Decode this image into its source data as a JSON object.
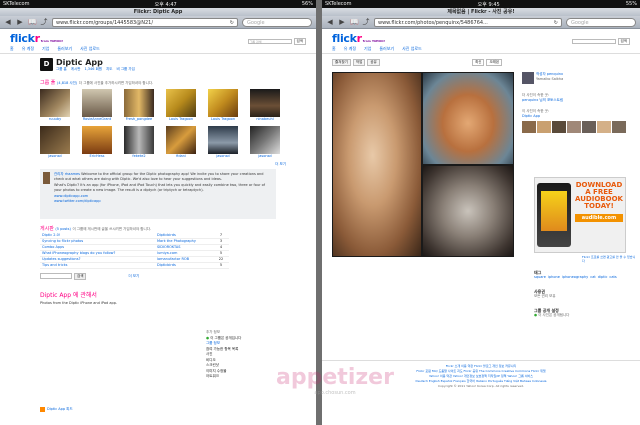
{
  "left": {
    "status": {
      "carrier": "SKTelecom",
      "time": "오후 4:47",
      "battery": "56%"
    },
    "browser_title": "Flickr: Diptic App",
    "url": "www.flickr.com/groups/1445583@N21/",
    "search_placeholder": "Google",
    "nav": [
      "홈",
      "유 계정",
      "기업",
      "둘러보기",
      "사진 업로드"
    ],
    "site_search_placeholder": "그룹 검색",
    "group": {
      "name": "Diptic App",
      "tabs": [
        "그룹 홈",
        "게시판",
        "1,346 회원",
        "지도",
        "비 그룹 가입"
      ],
      "pool_title": "그룹 풀",
      "pool_count": "(4,818 사진)",
      "pool_note": "더 그룹에 사진을 추가하시려면 가입하셔야 합니다.",
      "thumbs": [
        "ruuuby",
        "RosieAnneGrant",
        "Fresh_pongdee",
        "Louis Tragoon",
        "Louis Tragoon",
        "ninabeuhl",
        "jasonsd",
        "EricHess",
        "fekete2",
        "fidani",
        "jasonsd",
        "jasonsd"
      ],
      "more_link": "더 보기",
      "admin": "관리자 rhaames",
      "description": "Welcome to the official group for the Diptic photography app! We invite you to share your creations and check out what others are doing with Diptic. We'd also love to hear your suggestions and ideas.",
      "description2": "What's Diptic? It's an app (for iPhone, iPad and iPod Touch) that lets you quickly and easily combine two, three or four of your photos to create a new image. The result is a diptych (or triptych or tetraptych).",
      "links": [
        "www.dipticapp.com",
        "www.twitter.com/dipticapp"
      ],
      "discussion_title": "게시판",
      "discussion_count": "(5 posts)",
      "discussion_note": "이 그룹에 게시판에 글을 쓰시려면 가입하셔야 합니다.",
      "threads": [
        {
          "title": "Diptic 2.0!",
          "author": "Dipticbirds",
          "count": "7"
        },
        {
          "title": "Syncing to flickr photos",
          "author": "Mark the Photography",
          "count": "3"
        },
        {
          "title": "Combo Apps",
          "author": "SIDIOROKTAS",
          "count": "4"
        },
        {
          "title": "What iPhoneography blogs do you follow?",
          "author": "lumiya.com",
          "count": "5"
        },
        {
          "title": "Updates suggestions?",
          "author": "lomanufactor ROB",
          "count": "22"
        },
        {
          "title": "Tips and tricks",
          "author": "Dipticbirds",
          "count": "5"
        }
      ],
      "search_button": "검색",
      "more_threads": "더 보기",
      "map_title": "Diptic App 에 관해서",
      "map_desc": "Photos from the Diptic iPhone and iPad app.",
      "sidebar_title": "추가 정보",
      "sidebar_items": [
        "이 그룹은 공개입니다",
        "그룹 정보",
        "참여 가능한 항목 목록",
        "사진",
        "비디오",
        "스크린샷",
        "이미지 수정물",
        "아트워크"
      ],
      "footer": "Diptic App 피드"
    }
  },
  "right": {
    "status": {
      "carrier": "SKTelecom",
      "time": "오후 9:45",
      "battery": "55%"
    },
    "browser_title": "제목없음 | Flickr - 사진 공유!",
    "url": "www.flickr.com/photos/penquinx/5486764...",
    "search_placeholder": "Google",
    "nav": [
      "홈",
      "유 계정",
      "기업",
      "둘러보기",
      "사진 업로드"
    ],
    "toolbar": [
      "즐겨찾기",
      "작업",
      "공유"
    ],
    "toolbar_right": [
      "최신",
      "오래된"
    ],
    "owner": "작성자 penquinx",
    "owner_sub": "Yamaiko Salkha",
    "more_from": "더 사진이 속한 곳:",
    "more_link": "penquinx 님의 포토스트림",
    "group_title": "이 사진이 속한 곳:",
    "group_name": "Diptic App",
    "ad_headline": "DOWNLOAD A FREE AUDIOBOOK TODAY!",
    "ad_brand": "audible.com",
    "ad_note": "Flickr 프로를 쓰면 광고를 안 볼 수 있습니다",
    "tags_title": "태그",
    "tags": [
      "square",
      "iphone",
      "iphoneography",
      "cat",
      "diptic",
      "cats"
    ],
    "stats_title": "사용권",
    "stats_text": "모든 권리 보유",
    "privacy_title": "그룹 공개 설정",
    "privacy_text": "이 사진은 공개됩니다",
    "footer_rows": [
      "Flickr 소개  이용 약관  Flickr 블로그  개인 정보  커뮤니티",
      "Flickr 포럼  FAQ  도움말  사이트 지도  Flickr 공유  The Commons  Creative Commons  Flickr 위젯",
      "Yahoo! 이용 약관  Yahoo! 개인정보 보호정책  저작권/IP 정책  Yahoo! 그룹 서비스",
      "Deutsch  English  Español  Français  한국어  Italiano  Português  Tiếng Việt  Bahasa Indonesia",
      "Copyright © 2011 Yahoo! Korea Corp. All rights reserved."
    ],
    "watermark": "appetizer",
    "watermark_sub": "app.chosun.com"
  }
}
